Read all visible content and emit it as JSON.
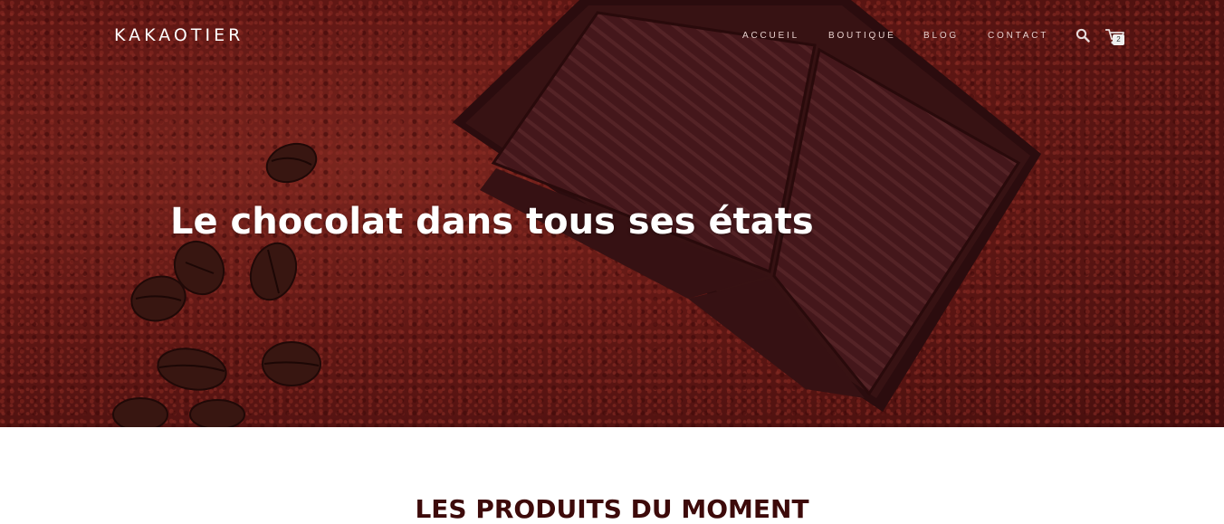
{
  "header": {
    "brand": "KAKAOTIER",
    "nav": [
      {
        "label": "ACCUEIL"
      },
      {
        "label": "BOUTIQUE"
      },
      {
        "label": "BLOG"
      },
      {
        "label": "CONTACT"
      }
    ],
    "search_icon": "search-icon",
    "cart_icon": "cart-icon",
    "cart_count": "2"
  },
  "hero": {
    "headline": "Le chocolat dans tous ses états"
  },
  "products_section": {
    "title": "LES PRODUITS DU MOMENT"
  },
  "colors": {
    "hero_base": "#6e1c18",
    "chocolate": "#4a1a1c",
    "section_title": "#3d0a0a",
    "nav_text": "#e6cfcc"
  }
}
